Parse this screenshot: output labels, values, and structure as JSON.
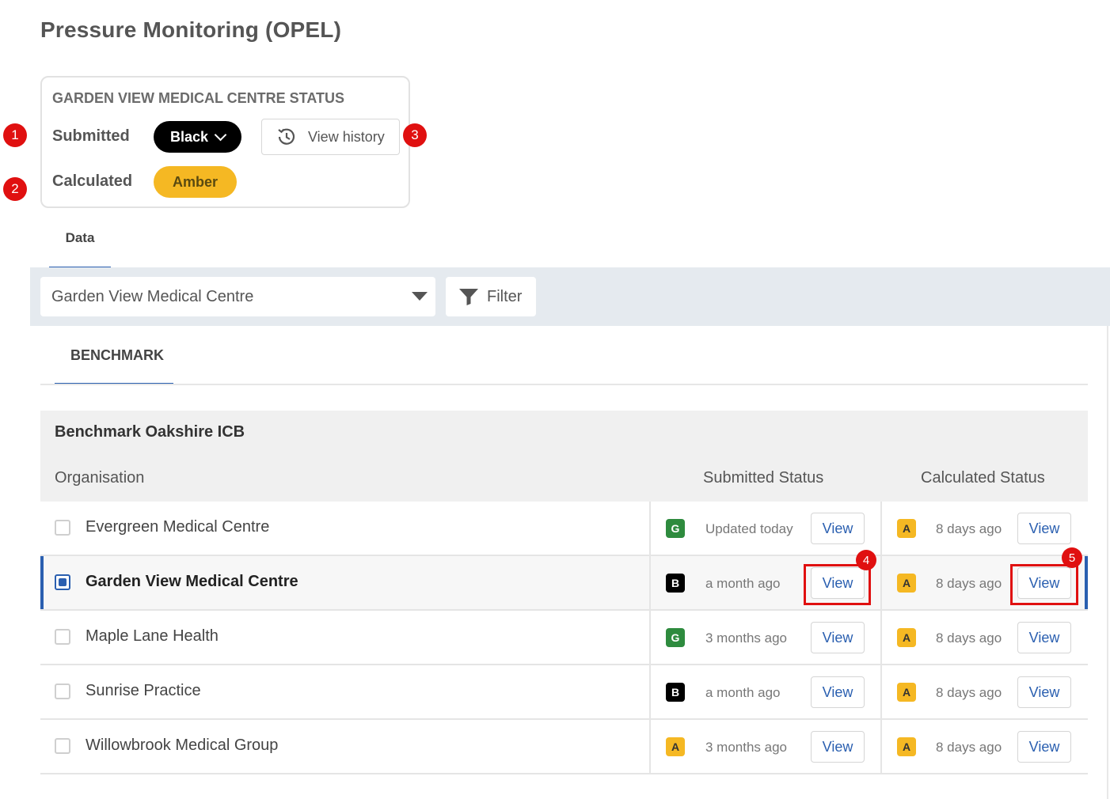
{
  "page_title": "Pressure Monitoring (OPEL)",
  "status_card": {
    "title": "GARDEN VIEW MEDICAL CENTRE STATUS",
    "submitted_label": "Submitted",
    "submitted_value": "Black",
    "calculated_label": "Calculated",
    "calculated_value": "Amber",
    "history_button": "View history"
  },
  "markers": [
    "1",
    "2",
    "3",
    "4",
    "5"
  ],
  "tabs": {
    "data": "Data",
    "benchmark": "BENCHMARK"
  },
  "toolbar": {
    "selected_org": "Garden View Medical Centre",
    "filter_label": "Filter"
  },
  "table": {
    "caption": "Benchmark Oakshire ICB",
    "columns": {
      "organisation": "Organisation",
      "submitted": "Submitted Status",
      "calculated": "Calculated Status"
    },
    "view_label": "View",
    "rows": [
      {
        "name": "Evergreen Medical Centre",
        "selected": false,
        "sub_badge": "G",
        "sub_when": "Updated today",
        "calc_badge": "A",
        "calc_when": "8 days ago"
      },
      {
        "name": "Garden View Medical Centre",
        "selected": true,
        "sub_badge": "B",
        "sub_when": "a month ago",
        "calc_badge": "A",
        "calc_when": "8 days ago"
      },
      {
        "name": "Maple Lane Health",
        "selected": false,
        "sub_badge": "G",
        "sub_when": "3 months ago",
        "calc_badge": "A",
        "calc_when": "8 days ago"
      },
      {
        "name": "Sunrise Practice",
        "selected": false,
        "sub_badge": "B",
        "sub_when": "a month ago",
        "calc_badge": "A",
        "calc_when": "8 days ago"
      },
      {
        "name": "Willowbrook Medical Group",
        "selected": false,
        "sub_badge": "A",
        "sub_when": "3 months ago",
        "calc_badge": "A",
        "calc_when": "8 days ago"
      }
    ]
  },
  "colors": {
    "accent": "#2a5fb0",
    "black_status": "#000000",
    "amber_status": "#f5b823",
    "green_status": "#2e8b3e",
    "marker": "#e01010"
  }
}
